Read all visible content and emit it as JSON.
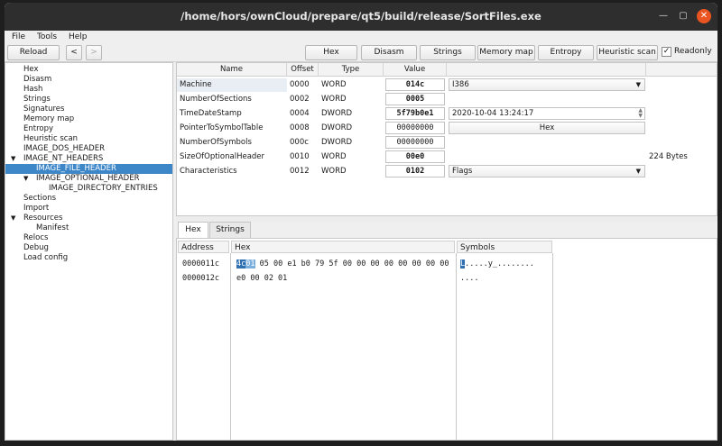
{
  "window": {
    "title": "/home/hors/ownCloud/prepare/qt5/build/release/SortFiles.exe"
  },
  "menu": [
    "File",
    "Tools",
    "Help"
  ],
  "toolbar": {
    "reload": "Reload",
    "back": "<",
    "forward": ">",
    "hex": "Hex",
    "disasm": "Disasm",
    "strings": "Strings",
    "memory_map": "Memory map",
    "entropy": "Entropy",
    "heuristic": "Heuristic scan",
    "readonly_label": "Readonly",
    "readonly_checked": "✓"
  },
  "tree": [
    "Hex",
    "Disasm",
    "Hash",
    "Strings",
    "Signatures",
    "Memory map",
    "Entropy",
    "Heuristic scan",
    "IMAGE_DOS_HEADER",
    "IMAGE_NT_HEADERS",
    "IMAGE_FILE_HEADER",
    "IMAGE_OPTIONAL_HEADER",
    "IMAGE_DIRECTORY_ENTRIES",
    "Sections",
    "Import",
    "Resources",
    "Manifest",
    "Relocs",
    "Debug",
    "Load config"
  ],
  "table": {
    "headers": [
      "Name",
      "Offset",
      "Type",
      "Value"
    ],
    "rows": [
      {
        "name": "Machine",
        "offset": "0000",
        "type": "WORD",
        "value": "014c",
        "extra": "I386"
      },
      {
        "name": "NumberOfSections",
        "offset": "0002",
        "type": "WORD",
        "value": "0005",
        "extra": ""
      },
      {
        "name": "TimeDateStamp",
        "offset": "0004",
        "type": "DWORD",
        "value": "5f79b0e1",
        "extra": "2020-10-04 13:24:17"
      },
      {
        "name": "PointerToSymbolTable",
        "offset": "0008",
        "type": "DWORD",
        "value": "00000000",
        "extra": "Hex"
      },
      {
        "name": "NumberOfSymbols",
        "offset": "000c",
        "type": "DWORD",
        "value": "00000000",
        "extra": ""
      },
      {
        "name": "SizeOfOptionalHeader",
        "offset": "0010",
        "type": "WORD",
        "value": "00e0",
        "extra": "",
        "comment": "224 Bytes"
      },
      {
        "name": "Characteristics",
        "offset": "0012",
        "type": "WORD",
        "value": "0102",
        "extra": "Flags"
      }
    ]
  },
  "tabs": [
    "Hex",
    "Strings"
  ],
  "hexview": {
    "headers": [
      "Address",
      "Hex",
      "Symbols"
    ],
    "rows": [
      {
        "address": "0000011c",
        "hex_sel1": "4c",
        "hex_sel2": "01",
        "hex_rest": " 05 00 e1 b0 79 5f 00 00 00 00 00 00 00 00",
        "sym_sel": "L",
        "sym_rest": ".....y_........"
      },
      {
        "address": "0000012c",
        "hex_sel1": "",
        "hex_sel2": "",
        "hex_rest": "e0 00 02 01",
        "sym_sel": "",
        "sym_rest": "...."
      }
    ]
  },
  "colors": {
    "titlebar": "#2e2e2e",
    "close": "#e95420",
    "selection": "#3d87c9"
  }
}
